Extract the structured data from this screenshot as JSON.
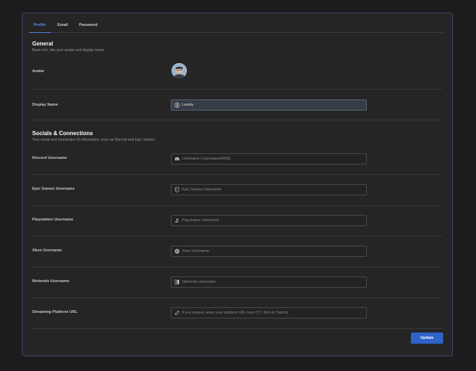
{
  "tabs": [
    {
      "label": "Profile",
      "active": true
    },
    {
      "label": "Email",
      "active": false
    },
    {
      "label": "Password",
      "active": false
    }
  ],
  "general": {
    "title": "General",
    "subtitle": "Basic info, like your avatar and display name",
    "avatar_label": "Avatar",
    "display_name_label": "Display Name",
    "display_name_value": "Loooty"
  },
  "socials": {
    "title": "Socials & Connections",
    "subtitle": "Your social and connection ID information, such as Discord and Epic Games",
    "fields": [
      {
        "label": "Discord Username",
        "placeholder": "Username | Username#0000",
        "icon": "discord-icon"
      },
      {
        "label": "Epic Games Username",
        "placeholder": "Epic Games Username",
        "icon": "epic-games-icon"
      },
      {
        "label": "Playstation Username",
        "placeholder": "Playstation Username",
        "icon": "playstation-icon"
      },
      {
        "label": "Xbox Username",
        "placeholder": "Xbox Username",
        "icon": "xbox-icon"
      },
      {
        "label": "Nintendo Username",
        "placeholder": "Nintendo Username",
        "icon": "nintendo-icon"
      },
      {
        "label": "Streaming Platform URL",
        "placeholder": "If you stream, enter your platform URL here (YT, Kick or Twitch)",
        "icon": "link-icon"
      }
    ]
  },
  "update_label": "Update",
  "colors": {
    "accent": "#2f63c8",
    "tab_active": "#5b8ee8",
    "panel_border": "#3a4a70"
  }
}
